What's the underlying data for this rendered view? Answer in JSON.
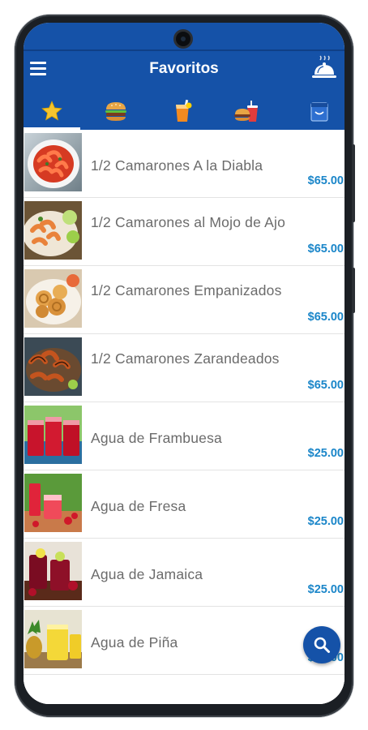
{
  "header": {
    "title": "Favoritos",
    "menu_icon": "hamburger-menu-icon",
    "action_icon": "cloche-icon"
  },
  "tabs": [
    {
      "icon": "star-icon",
      "selected": true
    },
    {
      "icon": "burger-icon",
      "selected": false
    },
    {
      "icon": "drink-glass-icon",
      "selected": false
    },
    {
      "icon": "combo-meal-icon",
      "selected": false
    },
    {
      "icon": "bag-icon",
      "selected": false
    }
  ],
  "items": [
    {
      "name": "1/2 Camarones A la Diabla",
      "price": "$65.00",
      "image": "spicy-shrimp-plate"
    },
    {
      "name": "1/2 Camarones al Mojo de Ajo",
      "price": "$65.00",
      "image": "garlic-shrimp-plate"
    },
    {
      "name": "1/2 Camarones Empanizados",
      "price": "$65.00",
      "image": "breaded-shrimp-plate"
    },
    {
      "name": "1/2 Camarones Zarandeados",
      "price": "$65.00",
      "image": "grilled-shrimp-plate"
    },
    {
      "name": "Agua de Frambuesa",
      "price": "$25.00",
      "image": "raspberry-drink"
    },
    {
      "name": "Agua de Fresa",
      "price": "$25.00",
      "image": "strawberry-drink"
    },
    {
      "name": "Agua de Jamaica",
      "price": "$25.00",
      "image": "hibiscus-drink"
    },
    {
      "name": "Agua de Piña",
      "price": "$25.00",
      "image": "pineapple-drink"
    }
  ],
  "fab": {
    "icon": "search-icon"
  },
  "colors": {
    "primary": "#1552a8",
    "price": "#1b86c9",
    "text": "#6b6b6b",
    "star": "#f4c430"
  }
}
